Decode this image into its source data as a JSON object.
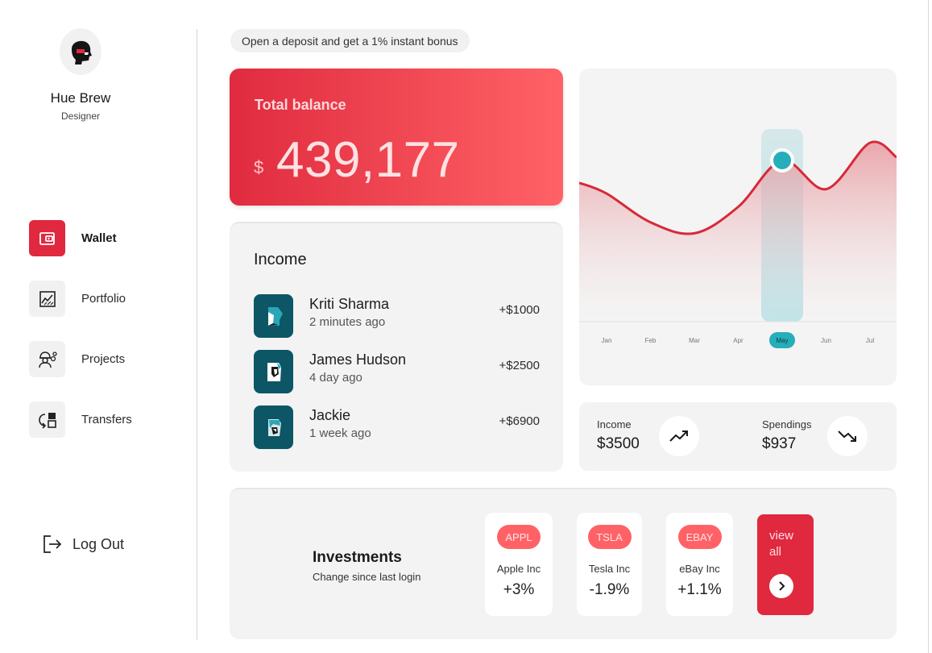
{
  "user": {
    "name": "Hue Brew",
    "role": "Designer"
  },
  "nav": [
    {
      "label": "Wallet",
      "icon": "wallet-icon",
      "active": true
    },
    {
      "label": "Portfolio",
      "icon": "chart-icon",
      "active": false
    },
    {
      "label": "Projects",
      "icon": "worker-gear-icon",
      "active": false
    },
    {
      "label": "Transfers",
      "icon": "transfer-icon",
      "active": false
    }
  ],
  "logout_label": "Log Out",
  "promo": "Open a deposit and get a 1% instant bonus",
  "balance": {
    "title": "Total balance",
    "currency": "$",
    "amount": "439,177"
  },
  "income": {
    "title": "Income",
    "items": [
      {
        "name": "Kriti Sharma",
        "time": "2 minutes ago",
        "amount": "+$1000"
      },
      {
        "name": "James Hudson",
        "time": "4 day ago",
        "amount": "+$2500"
      },
      {
        "name": "Jackie",
        "time": "1 week ago",
        "amount": "+$6900"
      }
    ]
  },
  "chart_data": {
    "type": "area",
    "categories": [
      "Jan",
      "Feb",
      "Mar",
      "Apr",
      "May",
      "Jun",
      "Jul"
    ],
    "values": [
      58,
      45,
      40,
      52,
      73,
      60,
      81
    ],
    "highlighted": "May",
    "ylim": [
      0,
      100
    ],
    "grid": false,
    "line_color": "#d62a3a",
    "fill_color": "#f0b4b8",
    "highlight_color": "#26aeba"
  },
  "stats": {
    "income": {
      "label": "Income",
      "value": "$3500",
      "icon": "trend-up-icon"
    },
    "spendings": {
      "label": "Spendings",
      "value": "$937",
      "icon": "trend-down-icon"
    }
  },
  "investments": {
    "title": "Investments",
    "subtitle": "Change since last login",
    "stocks": [
      {
        "ticker": "APPL",
        "name": "Apple Inc",
        "change": "+3%"
      },
      {
        "ticker": "TSLA",
        "name": "Tesla Inc",
        "change": "-1.9%"
      },
      {
        "ticker": "EBAY",
        "name": "eBay Inc",
        "change": "+1.1%"
      }
    ],
    "view_all": "view all"
  },
  "colors": {
    "accent": "#e0283f",
    "accent_light": "#ff6266",
    "teal": "#0c5666"
  }
}
